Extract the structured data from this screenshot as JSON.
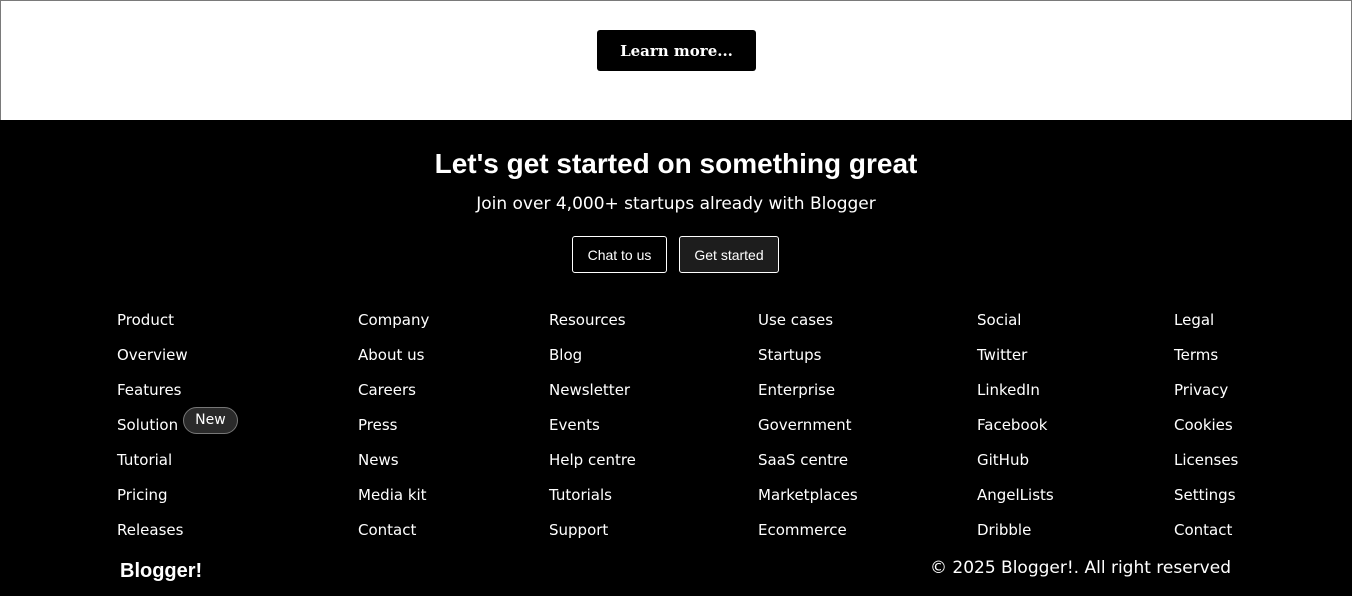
{
  "top": {
    "learn_more_label": "Learn more..."
  },
  "cta": {
    "headline": "Let's get started on something great",
    "subline": "Join over 4,000+ startups already with Blogger",
    "chat_label": "Chat to us",
    "start_label": "Get started"
  },
  "columns": [
    {
      "heading": "Product",
      "links": [
        "Overview",
        "Features",
        "Solution",
        "Tutorial",
        "Pricing",
        "Releases"
      ],
      "badge": "New"
    },
    {
      "heading": "Company",
      "links": [
        "About us",
        "Careers",
        "Press",
        "News",
        "Media kit",
        "Contact"
      ]
    },
    {
      "heading": "Resources",
      "links": [
        "Blog",
        "Newsletter",
        "Events",
        "Help centre",
        "Tutorials",
        "Support"
      ]
    },
    {
      "heading": "Use cases",
      "links": [
        "Startups",
        "Enterprise",
        "Government",
        "SaaS centre",
        "Marketplaces",
        "Ecommerce"
      ]
    },
    {
      "heading": "Social",
      "links": [
        "Twitter",
        "LinkedIn",
        "Facebook",
        "GitHub",
        "AngelLists",
        "Dribble"
      ]
    },
    {
      "heading": "Legal",
      "links": [
        "Terms",
        "Privacy",
        "Cookies",
        "Licenses",
        "Settings",
        "Contact"
      ]
    }
  ],
  "footer": {
    "brand": "Blogger!",
    "copyright": "© 2025 Blogger!. All right reserved"
  },
  "colors": {
    "background": "#000000",
    "top_background": "#ffffff",
    "text": "#ffffff"
  }
}
